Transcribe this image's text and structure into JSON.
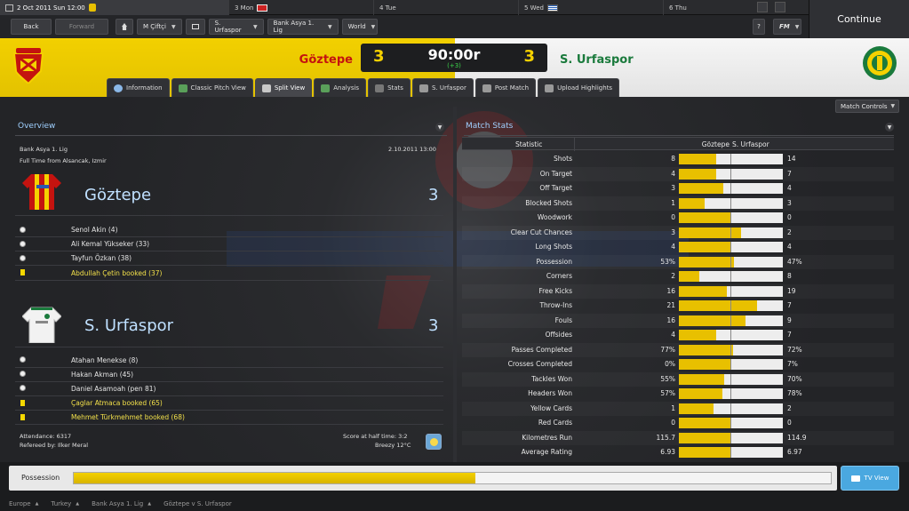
{
  "datebar": {
    "current_date": "2 Oct 2011 Sun 12:00",
    "days": [
      {
        "label": "3 Mon"
      },
      {
        "label": "4 Tue"
      },
      {
        "label": "5 Wed"
      },
      {
        "label": "6 Thu"
      }
    ]
  },
  "continue_label": "Continue",
  "nav": {
    "back": "Back",
    "forward": "Forward",
    "manager": "M Çiftçi",
    "club": "S. Urfaspor",
    "league": "Bank Asya 1. Lig",
    "world": "World",
    "help": "?",
    "fm": "FM"
  },
  "match": {
    "home_team": "Göztepe",
    "away_team": "S. Urfaspor",
    "home_score": "3",
    "away_score": "3",
    "clock": "90:00r",
    "added_time": "(+3)"
  },
  "tabs": [
    {
      "label": "Information"
    },
    {
      "label": "Classic Pitch View"
    },
    {
      "label": "Split View"
    },
    {
      "label": "Analysis"
    },
    {
      "label": "Stats"
    },
    {
      "label": "S. Urfaspor"
    },
    {
      "label": "Post Match"
    },
    {
      "label": "Upload Highlights"
    }
  ],
  "match_controls": "Match Controls",
  "overview": {
    "title": "Overview",
    "competition": "Bank Asya 1. Lig",
    "date": "2.10.2011 13:00",
    "venue": "Full Time from Alsancak, Izmir",
    "home": {
      "name": "Göztepe",
      "score": "3",
      "events": [
        {
          "text": "Senol Akin (4)",
          "type": "goal"
        },
        {
          "text": "Ali Kemal Yükseker (33)",
          "type": "goal"
        },
        {
          "text": "Tayfun Özkan (38)",
          "type": "goal"
        },
        {
          "text": "Abdullah Çetin booked (37)",
          "type": "booking"
        }
      ]
    },
    "away": {
      "name": "S. Urfaspor",
      "score": "3",
      "events": [
        {
          "text": "Atahan Menekse (8)",
          "type": "goal"
        },
        {
          "text": "Hakan Akman (45)",
          "type": "goal"
        },
        {
          "text": "Daniel Asamoah (pen 81)",
          "type": "goal"
        },
        {
          "text": "Çaglar Atmaca booked (65)",
          "type": "booking"
        },
        {
          "text": "Mehmet Türkmehmet booked (68)",
          "type": "booking"
        }
      ]
    },
    "attendance": "Attendance: 6317",
    "referee": "Refereed by: Ilker Meral",
    "half_time": "Score at half time: 3:2",
    "weather": "Breezy 12°C"
  },
  "stats": {
    "title": "Match Stats",
    "col_statistic": "Statistic",
    "col_home": "Göztepe",
    "col_away": "S. Urfaspor",
    "rows": [
      {
        "label": "Shots",
        "home": "8",
        "away": "14",
        "home_share": 0.36
      },
      {
        "label": "On Target",
        "home": "4",
        "away": "7",
        "home_share": 0.36
      },
      {
        "label": "Off Target",
        "home": "3",
        "away": "4",
        "home_share": 0.43
      },
      {
        "label": "Blocked Shots",
        "home": "1",
        "away": "3",
        "home_share": 0.25
      },
      {
        "label": "Woodwork",
        "home": "0",
        "away": "0",
        "home_share": 0.5
      },
      {
        "label": "Clear Cut Chances",
        "home": "3",
        "away": "2",
        "home_share": 0.6
      },
      {
        "label": "Long Shots",
        "home": "4",
        "away": "4",
        "home_share": 0.5
      },
      {
        "label": "Possession",
        "home": "53%",
        "away": "47%",
        "home_share": 0.53
      },
      {
        "label": "Corners",
        "home": "2",
        "away": "8",
        "home_share": 0.2
      },
      {
        "label": "Free Kicks",
        "home": "16",
        "away": "19",
        "home_share": 0.46
      },
      {
        "label": "Throw-Ins",
        "home": "21",
        "away": "7",
        "home_share": 0.75
      },
      {
        "label": "Fouls",
        "home": "16",
        "away": "9",
        "home_share": 0.64
      },
      {
        "label": "Offsides",
        "home": "4",
        "away": "7",
        "home_share": 0.36
      },
      {
        "label": "Passes Completed",
        "home": "77%",
        "away": "72%",
        "home_share": 0.52
      },
      {
        "label": "Crosses Completed",
        "home": "0%",
        "away": "7%",
        "home_share": 0.5
      },
      {
        "label": "Tackles Won",
        "home": "55%",
        "away": "70%",
        "home_share": 0.44
      },
      {
        "label": "Headers Won",
        "home": "57%",
        "away": "78%",
        "home_share": 0.42
      },
      {
        "label": "Yellow Cards",
        "home": "1",
        "away": "2",
        "home_share": 0.33
      },
      {
        "label": "Red Cards",
        "home": "0",
        "away": "0",
        "home_share": 0.5
      },
      {
        "label": "Kilometres Run",
        "home": "115.7",
        "away": "114.9",
        "home_share": 0.5
      },
      {
        "label": "Average Rating",
        "home": "6.93",
        "away": "6.97",
        "home_share": 0.5
      }
    ]
  },
  "possession": {
    "label": "Possession",
    "home_share": 0.53
  },
  "tv_view": "TV View",
  "breadcrumbs": [
    {
      "label": "Europe"
    },
    {
      "label": "Turkey"
    },
    {
      "label": "Bank Asya 1. Lig"
    },
    {
      "label": "Göztepe v S. Urfaspor"
    }
  ],
  "colors": {
    "home_yellow": "#e8c000",
    "home_red": "#c4130f",
    "away_green": "#1a7a3c",
    "accent_blue": "#4aa8e0"
  }
}
